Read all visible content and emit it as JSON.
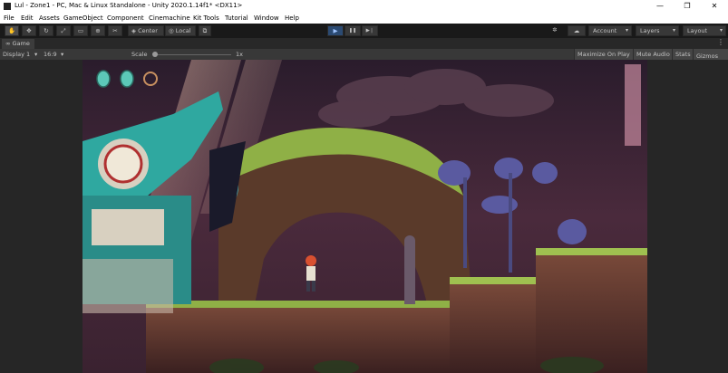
{
  "window": {
    "title": "Lul - Zone1 - PC, Mac & Linux Standalone - Unity 2020.1.14f1* <DX11>"
  },
  "window_controls": {
    "minimize": "—",
    "maximize": "❐",
    "close": "✕"
  },
  "menu": [
    "File",
    "Edit",
    "Assets",
    "GameObject",
    "Component",
    "Cinemachine",
    "Kit Tools",
    "Tutorial",
    "Window",
    "Help"
  ],
  "toolbar": {
    "tools": [
      {
        "name": "hand-tool",
        "glyph": "✋",
        "active": true
      },
      {
        "name": "move-tool",
        "glyph": "✥"
      },
      {
        "name": "rotate-tool",
        "glyph": "↻"
      },
      {
        "name": "scale-tool",
        "glyph": "⤢"
      },
      {
        "name": "rect-tool",
        "glyph": "▭"
      },
      {
        "name": "transform-tool",
        "glyph": "⊕"
      },
      {
        "name": "custom-tool",
        "glyph": "✂"
      }
    ],
    "pivot_label": "Center",
    "pivot_icon": "◈",
    "space_label": "Local",
    "space_icon": "◎",
    "snap_icon": "⧉",
    "play_icon": "▶",
    "pause_icon": "❚❚",
    "step_icon": "▶❘",
    "collab_icon": "✲",
    "cloud_icon": "☁",
    "account_label": "Account",
    "layers_label": "Layers",
    "layout_label": "Layout",
    "dropdown_arrow": "▾"
  },
  "game_tab": {
    "icon": "∞",
    "label": "Game",
    "more_icon": "⋮"
  },
  "game_bar": {
    "display": "Display 1",
    "aspect": "16:9",
    "scale_label": "Scale",
    "scale_value": "1x",
    "maximize_on_play": "Maximize On Play",
    "mute_audio": "Mute Audio",
    "stats": "Stats",
    "gizmos": "Gizmos",
    "arrow": "▾"
  },
  "colors": {
    "editor_bg": "#191919",
    "toolbar_button": "#383838",
    "play_active": "#2b4a72",
    "game_sky": "#3a2438",
    "grass": "#8fb046"
  }
}
